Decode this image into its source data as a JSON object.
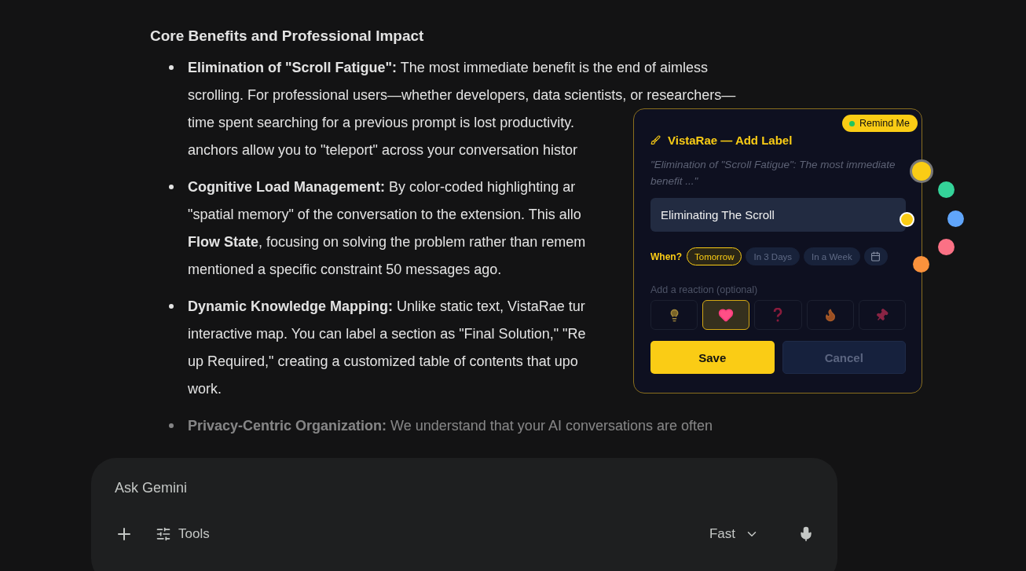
{
  "article": {
    "heading": "Core Benefits and Professional Impact",
    "bullets": [
      {
        "title": "Elimination of \"Scroll Fatigue\":",
        "faded": false,
        "lines": [
          "The most immediate benefit is the end of aimless",
          "scrolling. For professional users—whether developers, data scientists, or researchers—",
          "time spent searching for a previous prompt is lost productivity.",
          "anchors allow you to \"teleport\" across your conversation histor"
        ]
      },
      {
        "title": "Cognitive Load Management:",
        "faded": false,
        "lines": [
          "By color-coded highlighting ar",
          "\"spatial memory\" of the conversation to the extension. This allo",
          "**Flow State**, focusing on solving the problem rather than remem",
          "mentioned a specific constraint 50 messages ago."
        ]
      },
      {
        "title": "Dynamic Knowledge Mapping:",
        "faded": false,
        "lines": [
          "Unlike static text, VistaRae tur",
          "interactive map. You can label a section as \"Final Solution,\" \"Re",
          "up Required,\" creating a customized table of contents that upo",
          "work."
        ]
      },
      {
        "title": "Privacy-Centric Organization:",
        "faded": true,
        "lines": [
          "We understand that your AI conversations are often"
        ]
      }
    ]
  },
  "popup": {
    "badge": "Remind Me",
    "title": "VistaRae — Add Label",
    "quote": "\"Elimination of \"Scroll Fatigue\": The most immediate benefit ...\"",
    "label_value": "Eliminating The Scroll",
    "when": {
      "label": "When?",
      "options": [
        {
          "label": "Tomorrow",
          "selected": true
        },
        {
          "label": "In 3 Days",
          "selected": false
        },
        {
          "label": "In a Week",
          "selected": false
        }
      ]
    },
    "reaction_label": "Add a reaction (optional)",
    "reactions": [
      {
        "kind": "bulb",
        "selected": false
      },
      {
        "kind": "heart",
        "selected": true
      },
      {
        "kind": "question",
        "selected": false
      },
      {
        "kind": "flame",
        "selected": false
      },
      {
        "kind": "pin",
        "selected": false
      }
    ],
    "buttons": {
      "save": "Save",
      "cancel": "Cancel"
    }
  },
  "color_dots": [
    {
      "color": "#facc15",
      "selected": true
    },
    {
      "color": "#34d399",
      "selected": false
    },
    {
      "color": "#60a5fa",
      "selected": false
    },
    {
      "color": "#fb7185",
      "selected": false
    },
    {
      "color": "#fb923c",
      "selected": false
    }
  ],
  "field_dot": {
    "color": "#facc15"
  },
  "composer": {
    "placeholder": "Ask Gemini",
    "tools": "Tools",
    "mode": "Fast"
  }
}
